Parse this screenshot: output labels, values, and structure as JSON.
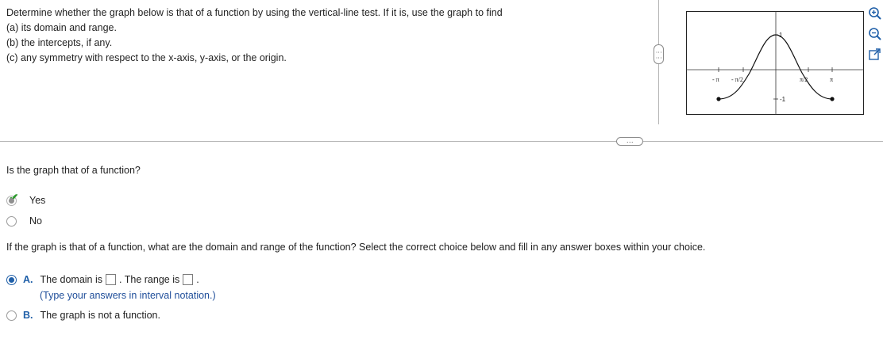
{
  "question": {
    "line1": "Determine whether the graph below is that of a function by using the vertical-line test.  If it is, use the graph to find",
    "line2": "(a) its domain and range.",
    "line3": "(b) the intercepts, if any.",
    "line4": "(c) any symmetry with respect to the x-axis, y-axis, or the origin."
  },
  "graph": {
    "x_tick_labels": [
      "- π",
      "- π/2",
      "π/2",
      "π"
    ],
    "y_tick_labels": [
      "1",
      "-1"
    ]
  },
  "handles": {
    "vertical": "⋮⋮",
    "horizontal": "⋯"
  },
  "part1": {
    "prompt": "Is the graph that of a function?",
    "options": [
      {
        "label": "Yes",
        "selected": true,
        "correct": true
      },
      {
        "label": "No",
        "selected": false
      }
    ]
  },
  "part2": {
    "prompt": "If the graph is that of a function, what are the domain and range of the function? Select the correct choice below and fill in any answer boxes within your choice.",
    "choice_a": {
      "letter": "A.",
      "domain_label": "The domain is",
      "range_label": ". The range is",
      "period": ".",
      "hint": "(Type your answers in interval notation.)"
    },
    "choice_b": {
      "letter": "B.",
      "text": "The graph is not a function."
    }
  },
  "colors": {
    "accent": "#1f5fa8",
    "check": "#2e9a2e",
    "divider": "#b5b5b5"
  },
  "icons": [
    "zoom-in-icon",
    "zoom-out-icon",
    "popout-icon"
  ]
}
